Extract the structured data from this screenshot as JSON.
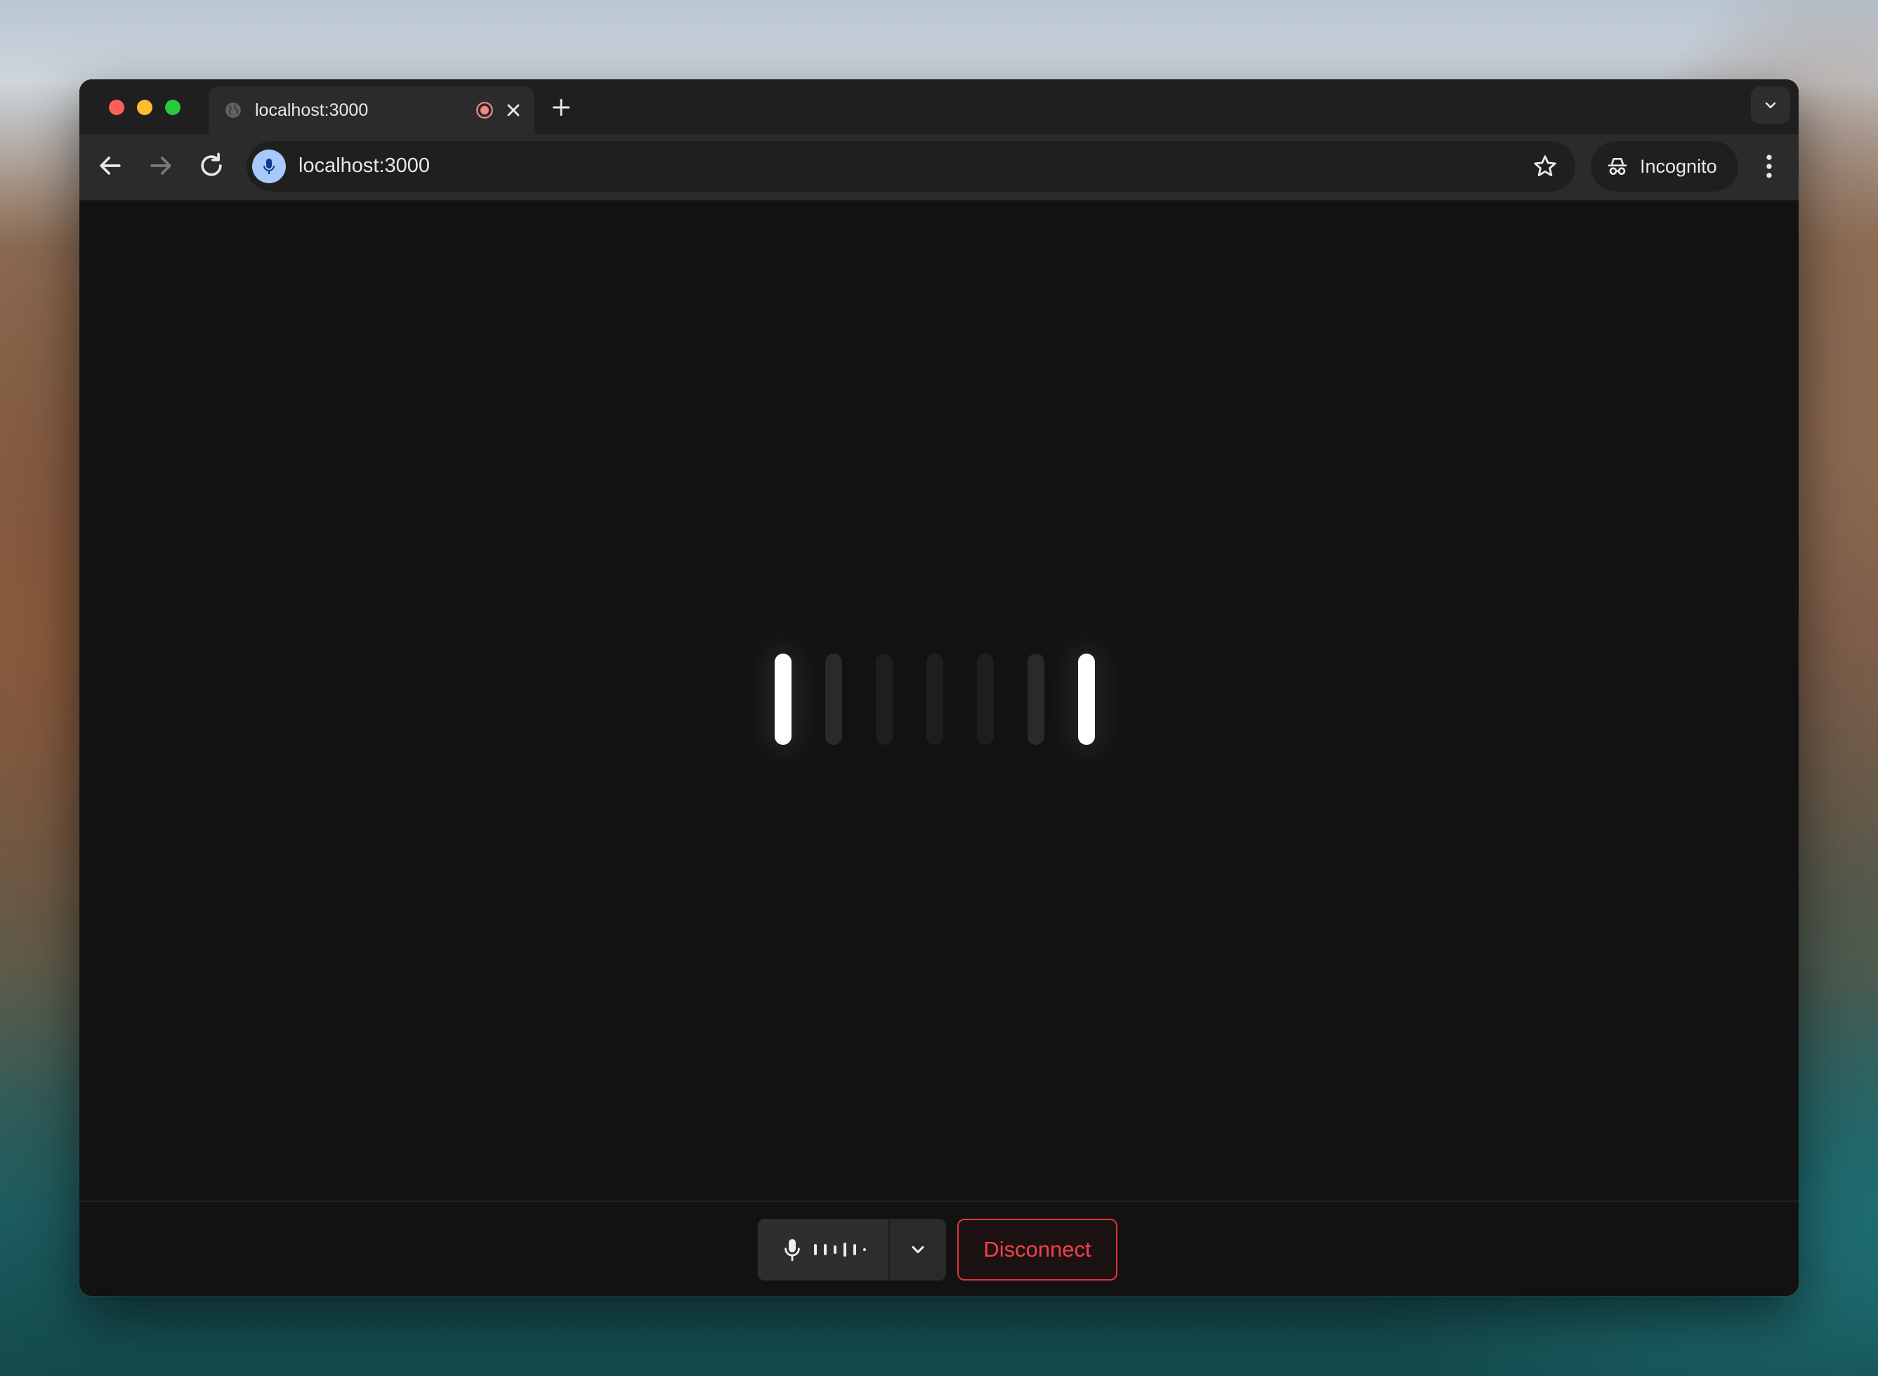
{
  "browser": {
    "tab": {
      "title": "localhost:3000",
      "favicon": "globe-icon",
      "status_icon": "recording-icon"
    },
    "omnibox": {
      "url": "localhost:3000",
      "site_icon": "microphone-icon"
    },
    "incognito_label": "Incognito",
    "accent_colors": {
      "close": "#ff5f57",
      "minimize": "#febc2e",
      "maximize": "#28c840",
      "site_badge": "#a8c7fa"
    }
  },
  "app": {
    "visualizer": {
      "bar_count": 7,
      "bar_states": [
        "active",
        "dim",
        "dim2",
        "dim2",
        "dim2",
        "dim",
        "active"
      ]
    },
    "controls": {
      "mic_icon": "microphone-icon",
      "dropdown_icon": "chevron-down-icon",
      "disconnect_label": "Disconnect",
      "disconnect_color": "#e5333d"
    }
  }
}
